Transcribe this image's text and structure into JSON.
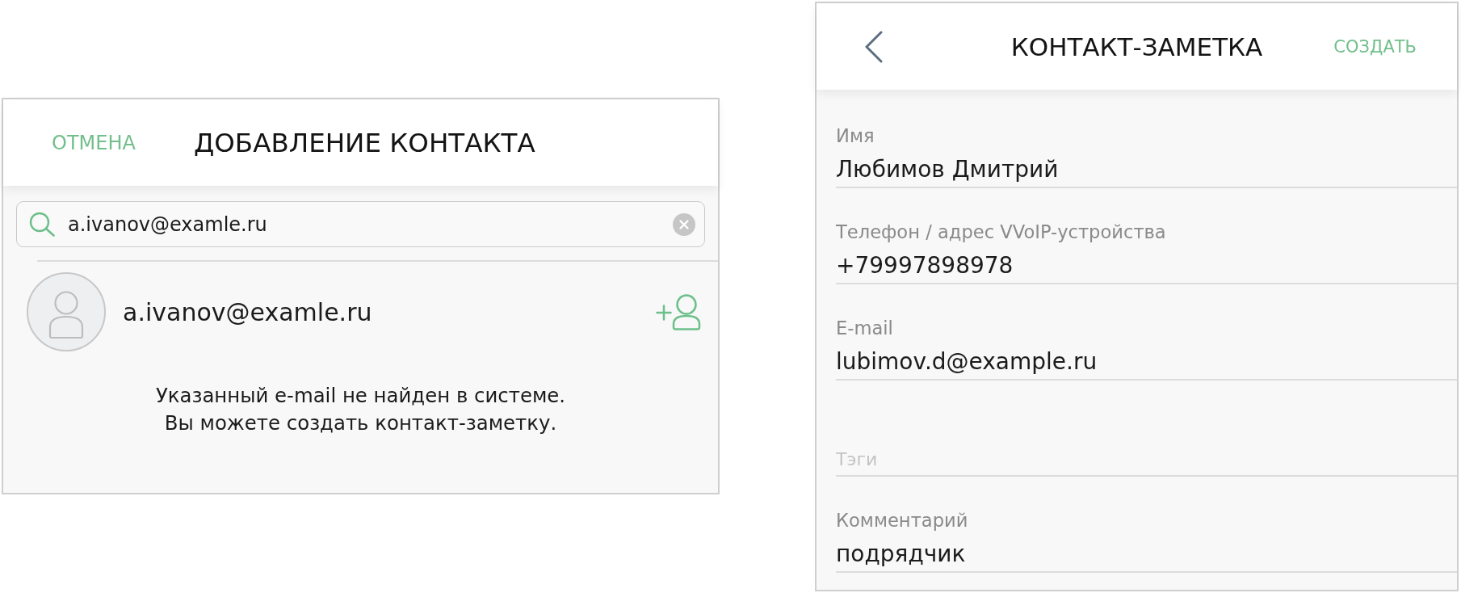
{
  "add_contact": {
    "cancel": "ОТМЕНА",
    "title": "ДОБАВЛЕНИЕ КОНТАКТА",
    "search": {
      "value": "a.ivanov@examle.ru"
    },
    "results": [
      {
        "email": "a.ivanov@examle.ru"
      }
    ],
    "message": "Указанный e-mail не найден в системе.\nВы можете создать контакт-заметку."
  },
  "contact_note": {
    "title": "КОНТАКТ-ЗАМЕТКА",
    "create": "СОЗДАТЬ",
    "fields": [
      {
        "label": "Имя",
        "value": "Любимов Дмитрий"
      },
      {
        "label": "Телефон / адрес VVoIP-устройства",
        "value": "+79997898978"
      },
      {
        "label": "E-mail",
        "value": "lubimov.d@example.ru"
      },
      {
        "placeholder": "Тэги"
      },
      {
        "label": "Комментарий",
        "value": "подрядчик"
      }
    ]
  }
}
